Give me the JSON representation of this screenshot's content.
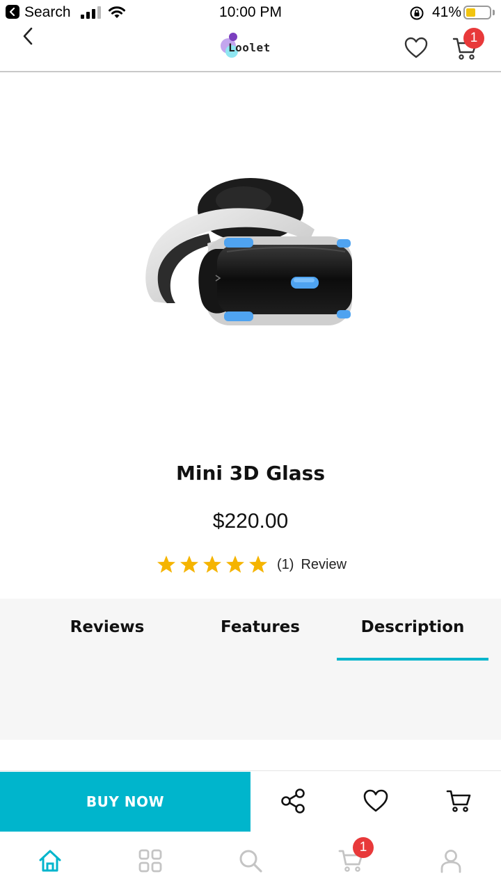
{
  "status_bar": {
    "back_app_label": "Search",
    "time": "10:00 PM",
    "battery_percent": "41%",
    "battery_level": 0.41
  },
  "header": {
    "logo_text": "Loolet",
    "cart_badge": "1"
  },
  "product": {
    "title": "Mini 3D Glass",
    "price": "$220.00",
    "rating": 5,
    "rating_max": 5,
    "review_count": "(1)",
    "review_label": "Review"
  },
  "tabs": {
    "items": [
      {
        "label": "Reviews"
      },
      {
        "label": "Features"
      },
      {
        "label": "Description"
      }
    ],
    "active": "Description"
  },
  "action_bar": {
    "buy_now_label": "BUY NOW"
  },
  "bottom_nav": {
    "cart_badge": "1",
    "active": "home"
  },
  "colors": {
    "accent": "#00b5cc",
    "badge": "#e8393a",
    "star": "#f5b400",
    "inactive_icon": "#c4c4c4"
  }
}
